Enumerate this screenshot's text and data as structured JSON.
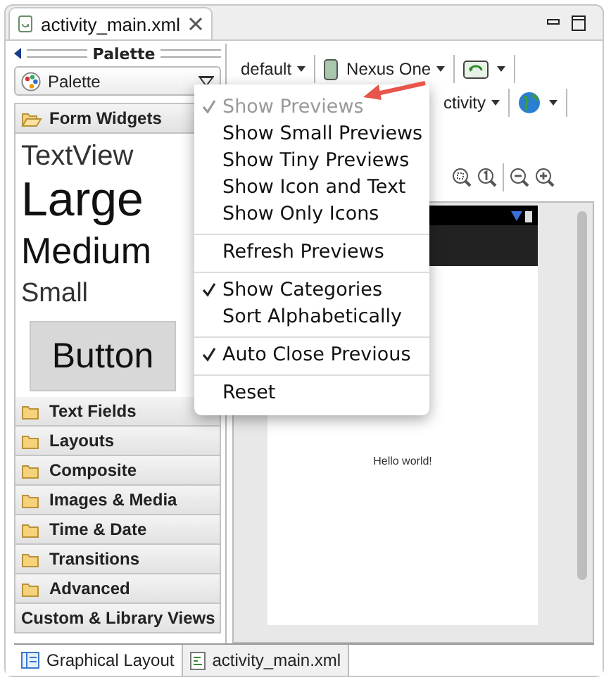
{
  "editor_tab": {
    "title": "activity_main.xml"
  },
  "palette": {
    "title": "Palette",
    "selector": "Palette",
    "open_category": {
      "label": "Form Widgets",
      "expanded": true
    },
    "previews": [
      {
        "kind": "textview",
        "label": "TextView"
      },
      {
        "kind": "large",
        "label": "Large"
      },
      {
        "kind": "medium",
        "label": "Medium"
      },
      {
        "kind": "small",
        "label": "Small"
      },
      {
        "kind": "button",
        "label": "Button"
      }
    ],
    "categories": [
      {
        "label": "Text Fields",
        "kind": "folder"
      },
      {
        "label": "Layouts",
        "kind": "folder"
      },
      {
        "label": "Composite",
        "kind": "folder"
      },
      {
        "label": "Images & Media",
        "kind": "folder"
      },
      {
        "label": "Time & Date",
        "kind": "folder"
      },
      {
        "label": "Transitions",
        "kind": "folder"
      },
      {
        "label": "Advanced",
        "kind": "folder"
      },
      {
        "label": "Custom & Library Views",
        "kind": "plain"
      }
    ]
  },
  "toolbar": {
    "theme": "default",
    "device": "Nexus One",
    "activity": "ctivity"
  },
  "canvas": {
    "text": "Hello world!"
  },
  "menu": {
    "groups": [
      [
        {
          "label": "Show Previews",
          "checked": true,
          "disabled": true
        },
        {
          "label": "Show Small Previews",
          "checked": false,
          "disabled": false
        },
        {
          "label": "Show Tiny Previews",
          "checked": false,
          "disabled": false
        },
        {
          "label": "Show Icon and Text",
          "checked": false,
          "disabled": false
        },
        {
          "label": "Show Only Icons",
          "checked": false,
          "disabled": false
        }
      ],
      [
        {
          "label": "Refresh Previews",
          "checked": false,
          "disabled": false
        }
      ],
      [
        {
          "label": "Show Categories",
          "checked": true,
          "disabled": false
        },
        {
          "label": "Sort Alphabetically",
          "checked": false,
          "disabled": false
        }
      ],
      [
        {
          "label": "Auto Close Previous",
          "checked": true,
          "disabled": false
        }
      ],
      [
        {
          "label": "Reset",
          "checked": false,
          "disabled": false
        }
      ]
    ]
  },
  "bottom_tabs": [
    {
      "label": "Graphical Layout",
      "selected": true
    },
    {
      "label": "activity_main.xml",
      "selected": false
    }
  ]
}
